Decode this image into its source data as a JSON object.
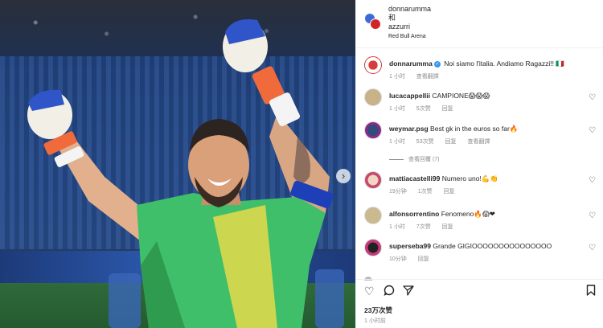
{
  "header": {
    "line1": "donnarumma",
    "line2": "和",
    "line3": "azzurri",
    "location": "Red Bull Arena"
  },
  "caption": {
    "username": "donnarumma",
    "text": "Noi siamo l'italia. Andiamo Ragazzi!! 🇮🇹",
    "time": "1 小时",
    "translate": "查看翻譯"
  },
  "comments": [
    {
      "username": "lucacappellii",
      "text": "CAMPIONE😱😱😱",
      "time": "1 小时",
      "likes": "5次赞",
      "reply": "回复"
    },
    {
      "username": "weymar.psg",
      "text": "Best gk in the euros so far🔥",
      "time": "1 小时",
      "likes": "53次赞",
      "reply": "回复",
      "translate": "查看翻譯",
      "view_replies": "查看回覆 (7)"
    },
    {
      "username": "mattiacastelli99",
      "text": "Numero uno!💪👏",
      "time": "19分钟",
      "likes": "1次赞",
      "reply": "回复"
    },
    {
      "username": "alfonsorrentino",
      "text": "Fenomeno🔥😱❤",
      "time": "1 小时",
      "likes": "7次赞",
      "reply": "回复"
    },
    {
      "username": "superseba99",
      "text": "Grande GIGIOOOOOOOOOOOOOOO",
      "time": "10分钟",
      "reply": "回复"
    }
  ],
  "footer": {
    "likes": "23万次赞",
    "time": "1 小时前"
  },
  "icons": {
    "heart": "heart-icon",
    "comment": "comment-icon",
    "share": "share-icon",
    "save": "bookmark-icon"
  },
  "colors": {
    "verified": "#3897f0",
    "muted": "#8e8e8e",
    "jersey_green": "#3fbf6a"
  }
}
